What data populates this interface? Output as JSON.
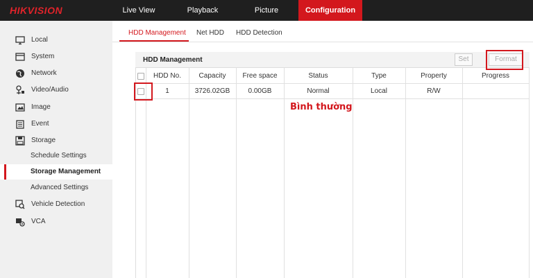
{
  "app": {
    "brand": "HIKVISION"
  },
  "nav": [
    {
      "label": "Live View",
      "active": false
    },
    {
      "label": "Playback",
      "active": false
    },
    {
      "label": "Picture",
      "active": false
    },
    {
      "label": "Configuration",
      "active": true
    }
  ],
  "sidebar": {
    "items": [
      {
        "label": "Local",
        "icon": "monitor-icon"
      },
      {
        "label": "System",
        "icon": "system-icon"
      },
      {
        "label": "Network",
        "icon": "globe-icon"
      },
      {
        "label": "Video/Audio",
        "icon": "video-audio-icon"
      },
      {
        "label": "Image",
        "icon": "image-icon"
      },
      {
        "label": "Event",
        "icon": "event-icon"
      },
      {
        "label": "Storage",
        "icon": "storage-icon"
      }
    ],
    "storage_sub": [
      {
        "label": "Schedule Settings",
        "active": false
      },
      {
        "label": "Storage Management",
        "active": true
      },
      {
        "label": "Advanced Settings",
        "active": false
      }
    ],
    "extra_items": [
      {
        "label": "Vehicle Detection",
        "icon": "vehicle-detection-icon"
      },
      {
        "label": "VCA",
        "icon": "vca-icon"
      }
    ]
  },
  "tabs": [
    {
      "label": "HDD Management",
      "active": true
    },
    {
      "label": "Net HDD",
      "active": false
    },
    {
      "label": "HDD Detection",
      "active": false
    }
  ],
  "panel": {
    "title": "HDD Management",
    "set_label": "Set",
    "format_label": "Format"
  },
  "table": {
    "headers": [
      "HDD No.",
      "Capacity",
      "Free space",
      "Status",
      "Type",
      "Property",
      "Progress"
    ],
    "rows": [
      {
        "hdd_no": "1",
        "capacity": "3726.02GB",
        "free_space": "0.00GB",
        "status": "Normal",
        "type": "Local",
        "property": "R/W",
        "progress": ""
      }
    ]
  },
  "annotation": {
    "status_note": "Bình thường"
  },
  "colors": {
    "accent": "#d3171d",
    "topbar": "#1f1f1f",
    "sidebar_bg": "#f0f0f0"
  }
}
